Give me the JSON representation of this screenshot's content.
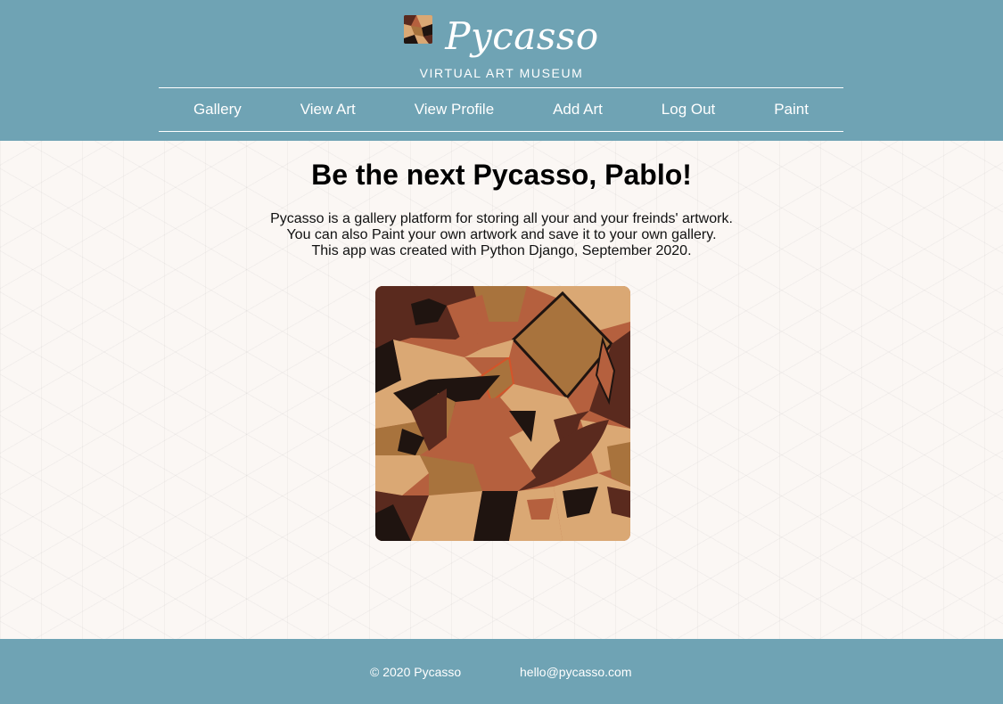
{
  "brand": {
    "logo_icon": "cubist-art-thumbnail",
    "name": "Pycasso",
    "tagline": "VIRTUAL ART MUSEUM"
  },
  "nav": {
    "items": [
      {
        "label": "Gallery"
      },
      {
        "label": "View Art"
      },
      {
        "label": "View Profile"
      },
      {
        "label": "Add Art"
      },
      {
        "label": "Log Out"
      },
      {
        "label": "Paint"
      }
    ]
  },
  "main": {
    "heading": "Be the next Pycasso, Pablo!",
    "intro_lines": [
      "Pycasso is a gallery platform for storing all your and your freinds' artwork.",
      "You can also Paint your own artwork and save it to your own gallery.",
      "This app was created with Python Django, September 2020."
    ],
    "featured_art_icon": "cubist-abstract-artwork"
  },
  "footer": {
    "copyright": "© 2020 Pycasso",
    "email": "hello@pycasso.com"
  },
  "colors": {
    "header_bg": "#6fa3b4",
    "page_bg": "#fbf7f4",
    "text_light": "#ffffff",
    "art_palette": [
      "#5a2a1e",
      "#b5603e",
      "#daa874",
      "#a8733d",
      "#1f1410",
      "#d4542a"
    ]
  }
}
